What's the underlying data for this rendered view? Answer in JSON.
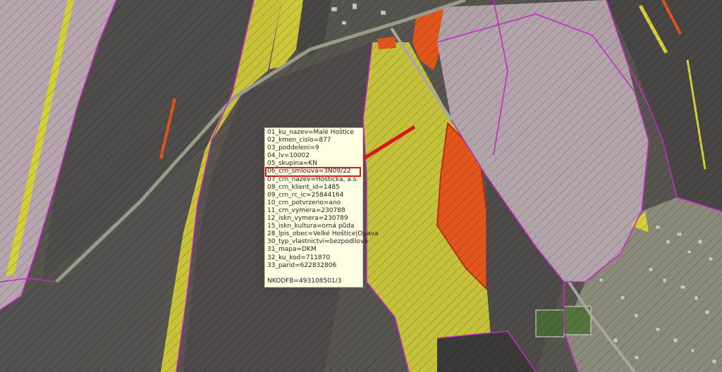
{
  "popup": {
    "rows": [
      "01_ku_nazev=Malé Hoštice",
      "02_kmen_cislo=877",
      "03_poddeleni=9",
      "04_lv=10002",
      "05_skupina=KN",
      "06_crn_smlouva=3N09/22",
      "07_crn_nazev=Hoštická, a.s.",
      "08_crn_klient_id=1485",
      "09_crn_rc_ic=25844164",
      "10_crn_potvrzeno=ano",
      "11_crn_vymera=230788",
      "12_iskn_vymera=230789",
      "15_iskn_kultura=orná půda",
      "28_lpis_obec=Velké Hoštice|Opava",
      "30_typ_vlastnictvi=bezpodílové",
      "31_mapa=DKM",
      "32_ku_kod=711870",
      "33_parid=622832806"
    ],
    "footer": "NKODFB=493108501/3",
    "ellipsis": "...",
    "highlighted_row": "06_crn_smlouva=3N09/22"
  },
  "colors": {
    "parcel_dark": "#4f4b49",
    "parcel_pink": "#b8a5ae",
    "parcel_yellow": "#c6c13a",
    "parcel_orange": "#e2561e",
    "boundary_magenta": "#c02cc0",
    "road_grey": "#9a9a88",
    "arrow_red": "#d11a1a"
  }
}
